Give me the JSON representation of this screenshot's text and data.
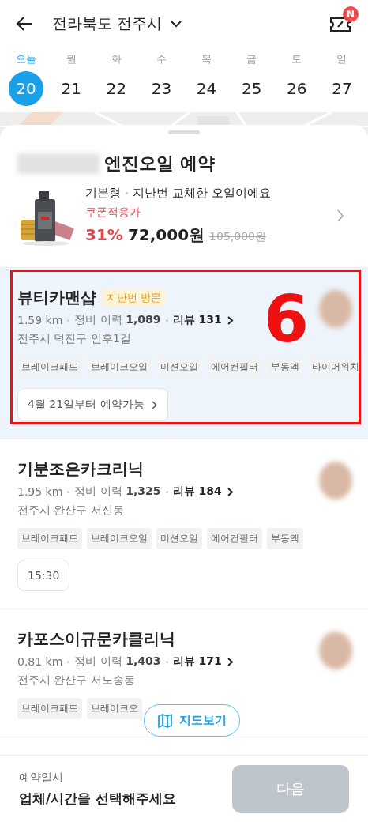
{
  "header": {
    "title": "전라북도 전주시",
    "badge": "N"
  },
  "week": [
    {
      "weekday": "오늘",
      "date": "20",
      "selected": true
    },
    {
      "weekday": "월",
      "date": "21",
      "selected": false
    },
    {
      "weekday": "화",
      "date": "22",
      "selected": false
    },
    {
      "weekday": "수",
      "date": "23",
      "selected": false
    },
    {
      "weekday": "목",
      "date": "24",
      "selected": false
    },
    {
      "weekday": "금",
      "date": "25",
      "selected": false
    },
    {
      "weekday": "토",
      "date": "26",
      "selected": false
    },
    {
      "weekday": "일",
      "date": "27",
      "selected": false
    }
  ],
  "product": {
    "title": "엔진오일 예약",
    "type": "기본형",
    "note": "지난번 교체한 오일이에요",
    "coupon_label": "쿠폰적용가",
    "discount": "31%",
    "price": "72,000원",
    "original_price": "105,000원"
  },
  "shops": [
    {
      "name": "뷰티카맨샵",
      "badge": "지난번 방문",
      "distance": "1.59 km",
      "history": "정비 이력 **1,089**",
      "review": "리뷰 131",
      "address": "전주시 덕진구 인후1길",
      "tags": [
        "브레이크패드",
        "브레이크오일",
        "미션오일",
        "에어컨필터",
        "부동액",
        "타이어위치"
      ],
      "slot": {
        "kind": "date",
        "label": "4월 21일부터 예약가능"
      },
      "highlighted": true,
      "annotation_label": "6"
    },
    {
      "name": "기분조은카크리닉",
      "distance": "1.95 km",
      "history": "정비 이력 **1,325**",
      "review": "리뷰 184",
      "address": "전주시 완산구 서신동",
      "tags": [
        "브레이크패드",
        "브레이크오일",
        "미션오일",
        "에어컨필터",
        "부동액"
      ],
      "slot": {
        "kind": "time",
        "label": "15:30"
      },
      "highlighted": false
    },
    {
      "name": "카포스이규문카클리닉",
      "distance": "0.81 km",
      "history": "정비 이력 **1,403**",
      "review": "리뷰 171",
      "address": "전주시 완산구 서노송동",
      "tags": [
        "브레이크패드",
        "브레이크오"
      ],
      "highlighted": false
    }
  ],
  "map_button": "지도보기",
  "bottom_bar": {
    "label": "예약일시",
    "value": "업체/시간을 선택해주세요",
    "next": "다음",
    "next_disabled": true
  }
}
